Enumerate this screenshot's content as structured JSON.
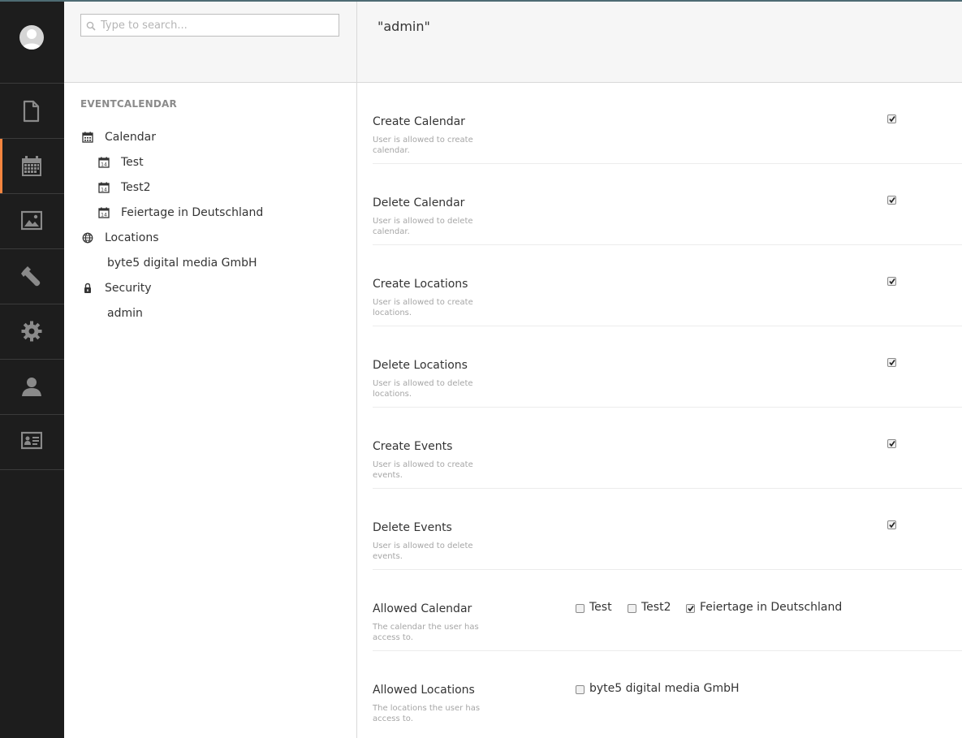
{
  "search": {
    "placeholder": "Type to search..."
  },
  "tree": {
    "section_title": "EVENTCALENDAR",
    "nodes": [
      {
        "label": "Calendar",
        "icon": "calendar-icon"
      },
      {
        "label": "Test",
        "icon": "calendar-day-icon"
      },
      {
        "label": "Test2",
        "icon": "calendar-day-icon"
      },
      {
        "label": "Feiertage in Deutschland",
        "icon": "calendar-day-icon"
      },
      {
        "label": "Locations",
        "icon": "globe-icon"
      },
      {
        "label": "byte5 digital media GmbH"
      },
      {
        "label": "Security",
        "icon": "lock-icon"
      },
      {
        "label": "admin"
      }
    ]
  },
  "app_sections": [
    {
      "icon": "document-icon"
    },
    {
      "icon": "calendar-icon",
      "active": true
    },
    {
      "icon": "image-icon"
    },
    {
      "icon": "wrench-icon"
    },
    {
      "icon": "gear-icon"
    },
    {
      "icon": "user-icon"
    },
    {
      "icon": "contact-card-icon"
    }
  ],
  "main": {
    "title": "\"admin\"",
    "permissions": [
      {
        "label": "Create Calendar",
        "description": "User is allowed to create calendar.",
        "checked": true
      },
      {
        "label": "Delete Calendar",
        "description": "User is allowed to delete calendar.",
        "checked": true
      },
      {
        "label": "Create Locations",
        "description": "User is allowed to create locations.",
        "checked": true
      },
      {
        "label": "Delete Locations",
        "description": "User is allowed to delete locations.",
        "checked": true
      },
      {
        "label": "Create Events",
        "description": "User is allowed to create events.",
        "checked": true
      },
      {
        "label": "Delete Events",
        "description": "User is allowed to delete events.",
        "checked": true
      }
    ],
    "allowed_calendar": {
      "label": "Allowed Calendar",
      "description": "The calendar the user has access to.",
      "options": [
        {
          "label": "Test",
          "checked": false
        },
        {
          "label": "Test2",
          "checked": false
        },
        {
          "label": "Feiertage in Deutschland",
          "checked": true
        }
      ]
    },
    "allowed_locations": {
      "label": "Allowed Locations",
      "description": "The locations the user has access to.",
      "options": [
        {
          "label": "byte5 digital media GmbH",
          "checked": false
        }
      ]
    }
  },
  "colors": {
    "accent": "#f5853f",
    "sidebar_bg": "#1d1d1d",
    "header_bg": "#f6f6f6",
    "icon_gray": "#8a8a8a"
  }
}
